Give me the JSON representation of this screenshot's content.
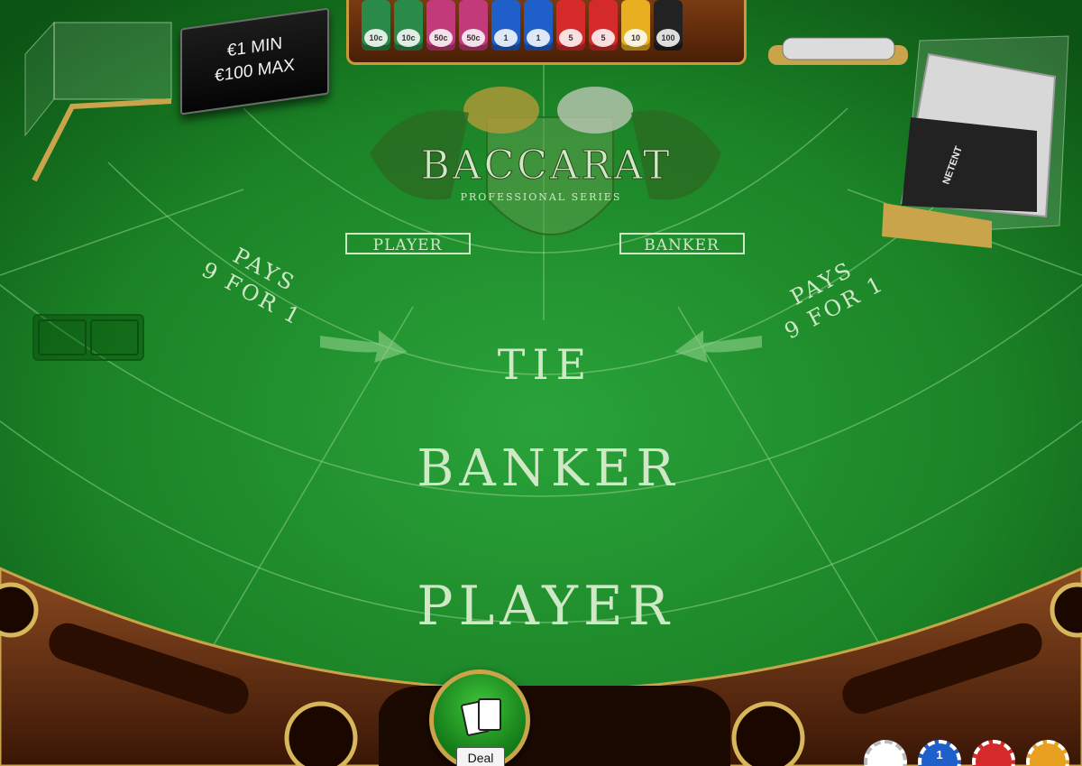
{
  "limits": {
    "min": "€1 MIN",
    "max": "€100 MAX"
  },
  "logo": {
    "title": "BACCARAT",
    "subtitle": "PROFESSIONAL SERIES",
    "player_label": "PLAYER",
    "banker_label": "BANKER"
  },
  "bets": {
    "tie": "TIE",
    "banker": "BANKER",
    "player": "PLAYER",
    "tie_payout_left": {
      "line1": "PAYS",
      "line2": "9 FOR 1"
    },
    "tie_payout_right": {
      "line1": "PAYS",
      "line2": "9 FOR 1"
    }
  },
  "chip_tray": [
    {
      "label": "10c",
      "color": "#2a8a4a"
    },
    {
      "label": "10c",
      "color": "#2a8a4a"
    },
    {
      "label": "50c",
      "color": "#c23a7a"
    },
    {
      "label": "50c",
      "color": "#c23a7a"
    },
    {
      "label": "1",
      "color": "#1f5fc9"
    },
    {
      "label": "1",
      "color": "#1f5fc9"
    },
    {
      "label": "5",
      "color": "#d42a2a"
    },
    {
      "label": "5",
      "color": "#d42a2a"
    },
    {
      "label": "10",
      "color": "#e8b020"
    },
    {
      "label": "100",
      "color": "#222222"
    }
  ],
  "shoe_brand": "NETENT",
  "deal_button": {
    "label": "Deal"
  },
  "bottom_chips": [
    {
      "label": "",
      "color": "#ffffff"
    },
    {
      "label": "1",
      "color": "#1f5fc9"
    },
    {
      "label": "",
      "color": "#d42a2a"
    },
    {
      "label": "",
      "color": "#e8a020"
    }
  ],
  "colors": {
    "felt": "#1f8f2a",
    "felt_dark": "#0d5a14",
    "rail": "#6b3214",
    "gold": "#c9a44a",
    "text": "#cfe8c6"
  }
}
